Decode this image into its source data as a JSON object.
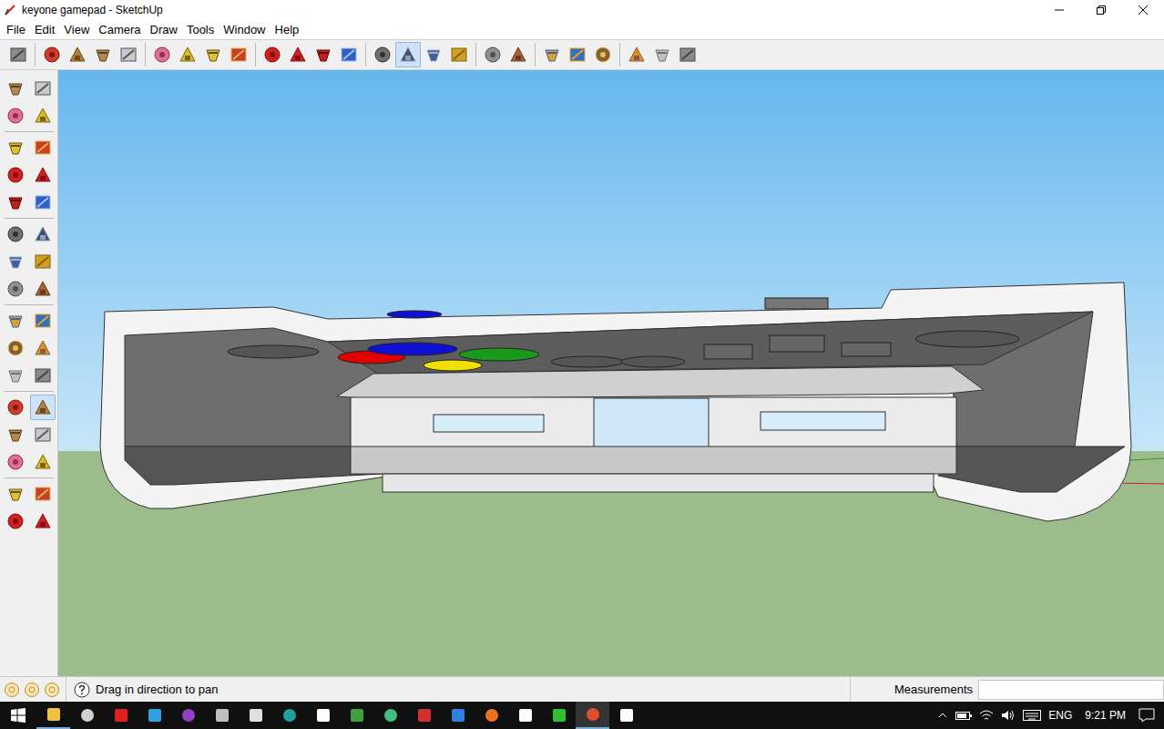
{
  "window": {
    "title": "keyone gamepad - SketchUp"
  },
  "menu": [
    "File",
    "Edit",
    "View",
    "Camera",
    "Draw",
    "Tools",
    "Window",
    "Help"
  ],
  "toolbar": {
    "groups": [
      [
        {
          "icon": "select",
          "selected": false
        }
      ],
      [
        {
          "icon": "pencil",
          "selected": false
        },
        {
          "icon": "rectangle",
          "selected": false
        },
        {
          "icon": "circle",
          "selected": false
        },
        {
          "icon": "arc",
          "selected": false
        }
      ],
      [
        {
          "icon": "make-component",
          "selected": false
        },
        {
          "icon": "eraser",
          "selected": false
        },
        {
          "icon": "tape",
          "selected": false
        },
        {
          "icon": "paint",
          "selected": false
        }
      ],
      [
        {
          "icon": "push-pull",
          "selected": false
        },
        {
          "icon": "move",
          "selected": false
        },
        {
          "icon": "rotate",
          "selected": false
        },
        {
          "icon": "offset",
          "selected": false
        }
      ],
      [
        {
          "icon": "orbit",
          "selected": false
        },
        {
          "icon": "pan",
          "selected": true
        },
        {
          "icon": "zoom",
          "selected": false
        },
        {
          "icon": "zoom-extents",
          "selected": false
        }
      ],
      [
        {
          "icon": "add-location",
          "selected": false
        },
        {
          "icon": "terrain",
          "selected": false
        }
      ],
      [
        {
          "icon": "warehouse",
          "selected": false
        },
        {
          "icon": "share-model",
          "selected": false
        },
        {
          "icon": "earth",
          "selected": false
        }
      ],
      [
        {
          "icon": "get-models",
          "selected": false
        },
        {
          "icon": "share-component",
          "selected": false
        },
        {
          "icon": "extension",
          "selected": false
        }
      ]
    ]
  },
  "side_toolbar": {
    "groups": [
      [
        {
          "icon": "select",
          "selected": false
        },
        {
          "icon": "make-component",
          "selected": false
        },
        {
          "icon": "paint",
          "selected": false
        },
        {
          "icon": "eraser",
          "selected": false
        }
      ],
      [
        {
          "icon": "rectangle",
          "selected": false
        },
        {
          "icon": "pencil",
          "selected": false
        },
        {
          "icon": "circle",
          "selected": false
        },
        {
          "icon": "arc",
          "selected": false
        },
        {
          "icon": "polygon",
          "selected": false
        },
        {
          "icon": "freehand",
          "selected": false
        }
      ],
      [
        {
          "icon": "move",
          "selected": false
        },
        {
          "icon": "push-pull",
          "selected": false
        },
        {
          "icon": "rotate",
          "selected": false
        },
        {
          "icon": "follow-me",
          "selected": false
        },
        {
          "icon": "scale",
          "selected": false
        },
        {
          "icon": "offset",
          "selected": false
        }
      ],
      [
        {
          "icon": "tape",
          "selected": false
        },
        {
          "icon": "dimension",
          "selected": false
        },
        {
          "icon": "protractor",
          "selected": false
        },
        {
          "icon": "text",
          "selected": false
        },
        {
          "icon": "axes",
          "selected": false
        },
        {
          "icon": "3d-text",
          "selected": false
        }
      ],
      [
        {
          "icon": "orbit",
          "selected": false
        },
        {
          "icon": "pan",
          "selected": true
        },
        {
          "icon": "zoom",
          "selected": false
        },
        {
          "icon": "zoom-window",
          "selected": false
        },
        {
          "icon": "previous",
          "selected": false
        },
        {
          "icon": "zoom-extents",
          "selected": false
        }
      ],
      [
        {
          "icon": "position-camera",
          "selected": false
        },
        {
          "icon": "look-around",
          "selected": false
        },
        {
          "icon": "walk",
          "selected": false
        },
        {
          "icon": "section-plane",
          "selected": false
        }
      ]
    ]
  },
  "status_bar": {
    "hint": "Drag in direction to pan",
    "measurements_label": "Measurements",
    "measurements_value": ""
  },
  "taskbar": {
    "language": "ENG",
    "time": "9:21 PM"
  }
}
